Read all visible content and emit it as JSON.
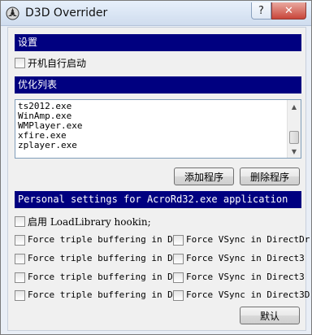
{
  "window": {
    "title": "D3D Overrider",
    "help_glyph": "?",
    "close_glyph": "✕"
  },
  "settings": {
    "header": "设置",
    "autostart_label": "开机自行启动"
  },
  "optimize": {
    "header": "优化列表",
    "items": [
      "ts2012.exe",
      "WinAmp.exe",
      "WMPlayer.exe",
      "xfire.exe",
      "zplayer.exe"
    ],
    "add_button": "添加程序",
    "remove_button": "删除程序"
  },
  "personal": {
    "header": "Personal settings for AcroRd32.exe application",
    "loadlibrary_label": "启用 LoadLibrary hookin;",
    "left_options": [
      "Force triple buffering in Dir",
      "Force triple buffering in Di",
      "Force triple buffering in Di",
      "Force triple buffering in Dir"
    ],
    "right_options": [
      "Force VSync in DirectDr",
      "Force VSync in Direct3",
      "Force VSync in Direct3",
      "Force VSync in Direct3D"
    ]
  },
  "footer": {
    "default_button": "默认"
  }
}
